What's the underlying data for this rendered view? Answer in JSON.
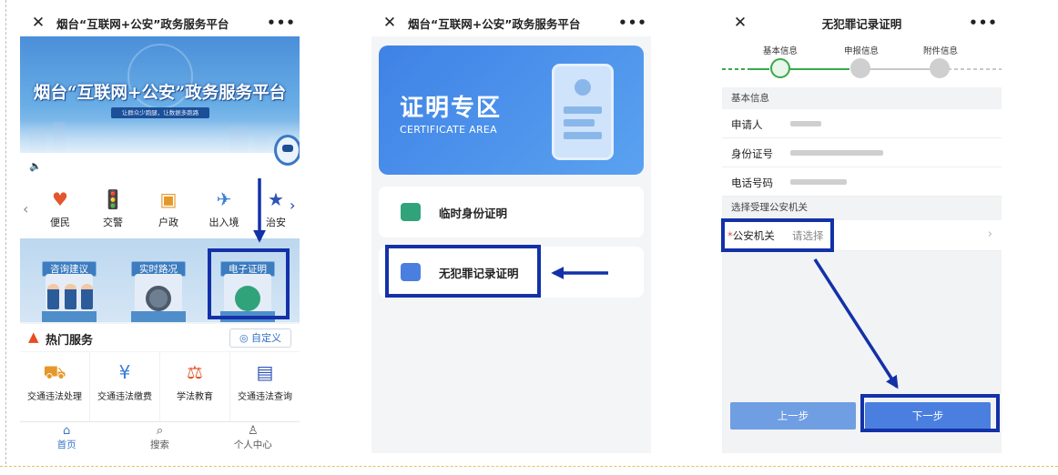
{
  "panel1": {
    "top_bar": {
      "title": "烟台“互联网+公安”政务服务平台",
      "close_icon": "close-icon",
      "more_icon": "more-icon"
    },
    "banner": {
      "title": "烟台“互联网+公安”政务服务平台",
      "subtitle": "让群众少跑腿，让数据多跑路"
    },
    "categories": [
      {
        "label": "便民",
        "icon": "heart-shield-icon"
      },
      {
        "label": "交警",
        "icon": "traffic-light-icon"
      },
      {
        "label": "户政",
        "icon": "household-register-icon"
      },
      {
        "label": "出入境",
        "icon": "airplane-icon"
      },
      {
        "label": "治安",
        "icon": "police-badge-icon"
      }
    ],
    "services": [
      {
        "label": "咨询建议"
      },
      {
        "label": "实时路况"
      },
      {
        "label": "电子证明"
      }
    ],
    "hot": {
      "title": "热门服务",
      "customize": "自定义"
    },
    "tiles": [
      {
        "label": "交通违法处理"
      },
      {
        "label": "交通违法缴费"
      },
      {
        "label": "学法教育"
      },
      {
        "label": "交通违法查询"
      }
    ],
    "tabbar": [
      {
        "label": "首页",
        "icon": "home-icon"
      },
      {
        "label": "搜索",
        "icon": "search-icon"
      },
      {
        "label": "个人中心",
        "icon": "user-icon"
      }
    ]
  },
  "panel2": {
    "top_bar": {
      "title": "烟台“互联网+公安”政务服务平台"
    },
    "card": {
      "title": "证明专区",
      "subtitle": "CERTIFICATE AREA"
    },
    "items": [
      {
        "label": "临时身份证明"
      },
      {
        "label": "无犯罪记录证明"
      }
    ]
  },
  "panel3": {
    "top_bar": {
      "title": "无犯罪记录证明"
    },
    "steps": [
      {
        "label": "基本信息"
      },
      {
        "label": "申报信息"
      },
      {
        "label": "附件信息"
      }
    ],
    "section_basic": "基本信息",
    "fields": [
      {
        "label": "申请人"
      },
      {
        "label": "身份证号"
      },
      {
        "label": "电话号码"
      }
    ],
    "section_org": "选择受理公安机关",
    "org_field": {
      "required_mark": "*",
      "label": "公安机关",
      "placeholder": "请选择"
    },
    "buttons": {
      "prev": "上一步",
      "next": "下一步"
    }
  },
  "colors": {
    "accent_blue": "#4a7fe0",
    "highlight": "#1331a8",
    "step_active": "#3aa84a",
    "hot_flame": "#e84b23"
  }
}
